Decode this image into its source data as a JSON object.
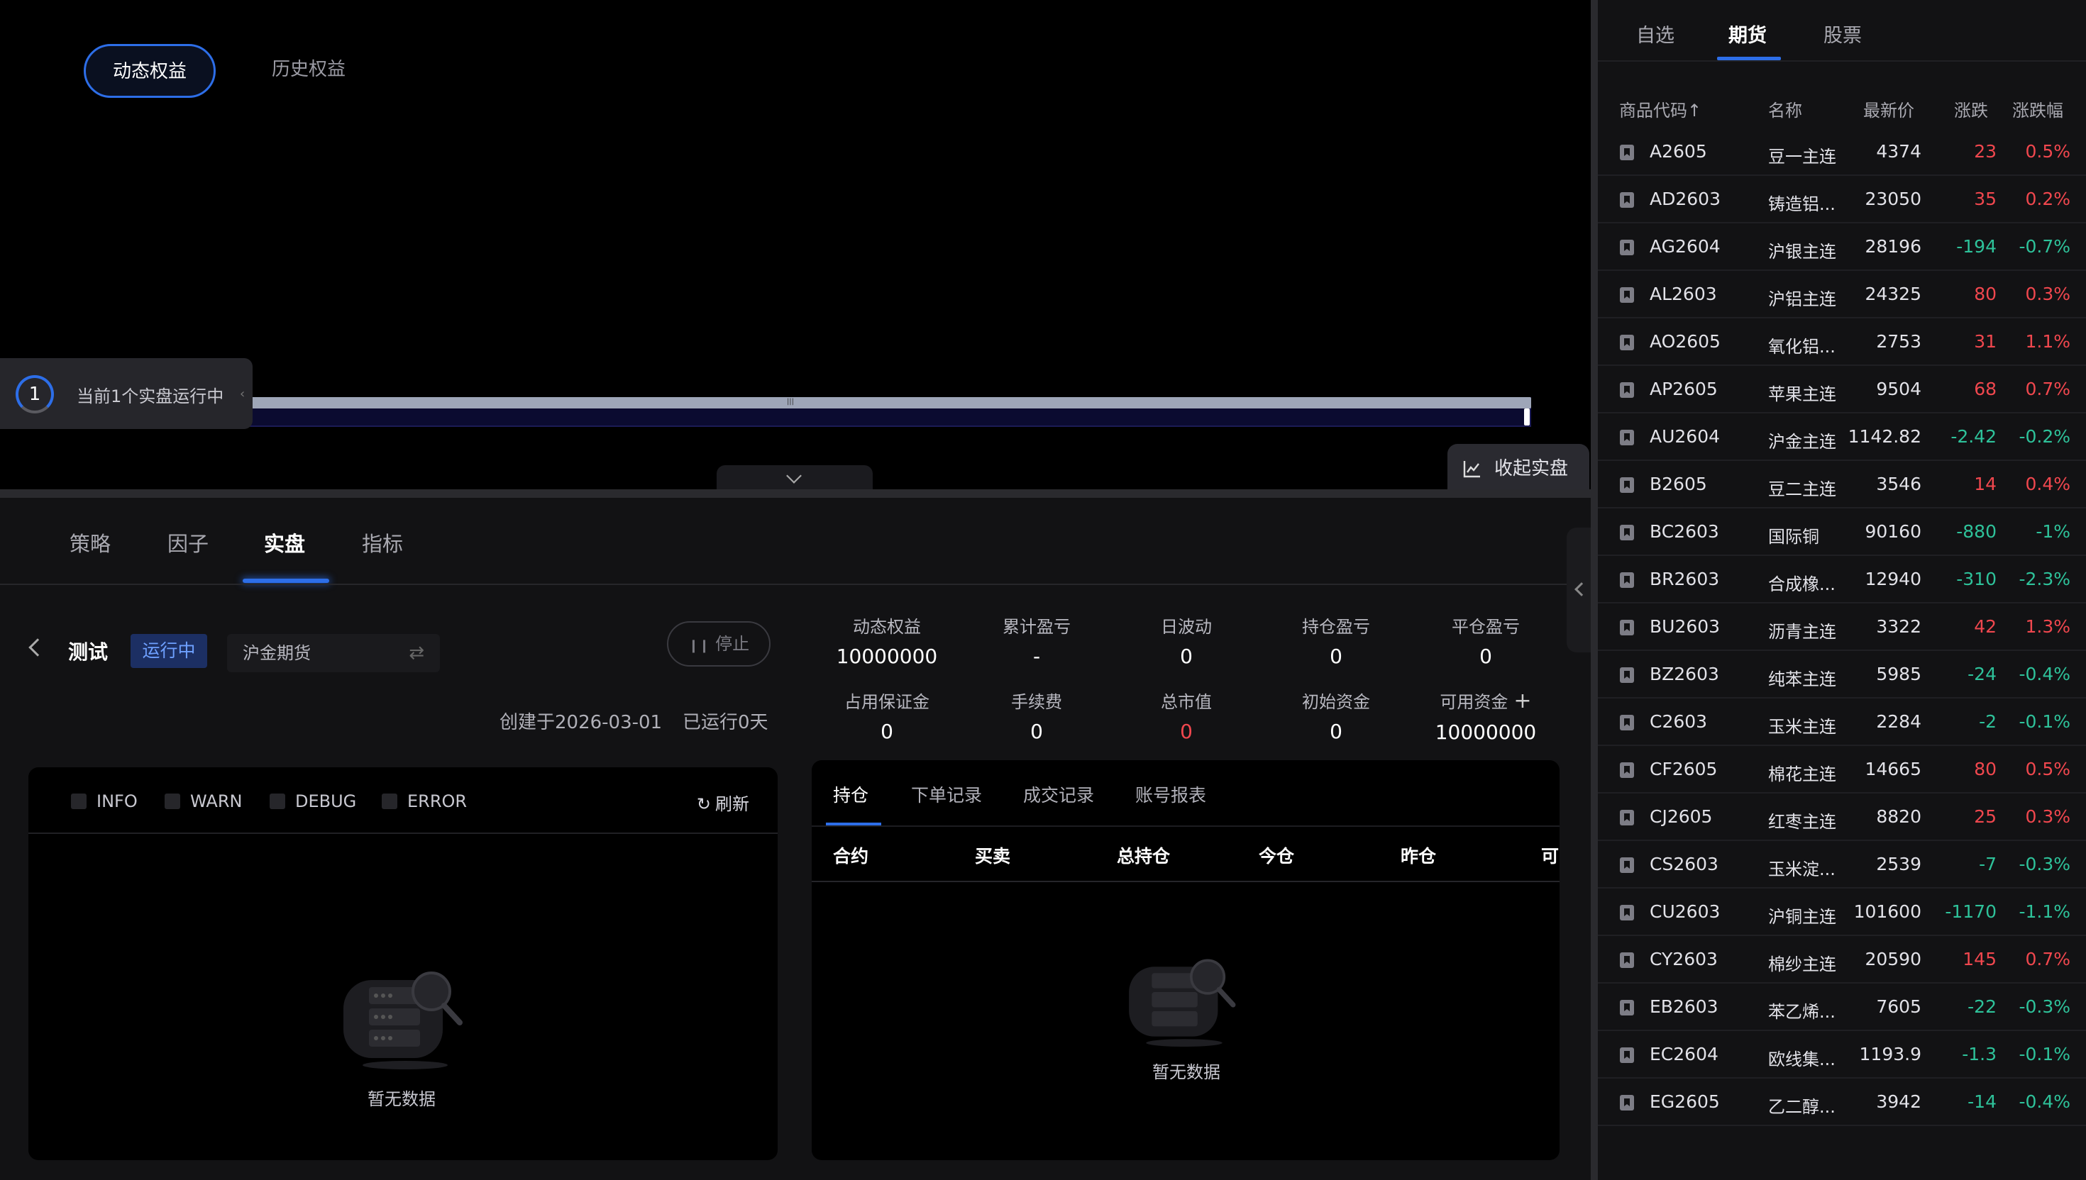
{
  "chart_header": {
    "tabs": [
      {
        "label": "动态权益",
        "active": true
      },
      {
        "label": "历史权益",
        "active": false
      }
    ]
  },
  "running_pill": {
    "count": "1",
    "text": "当前1个实盘运行中"
  },
  "collapse_live": {
    "label": "收起实盘"
  },
  "main_tabs": [
    {
      "label": "策略",
      "active": false
    },
    {
      "label": "因子",
      "active": false
    },
    {
      "label": "实盘",
      "active": true
    },
    {
      "label": "指标",
      "active": false
    }
  ],
  "strategy": {
    "name": "测试",
    "status": "运行中",
    "account": "沪金期货",
    "stop_label": "停止",
    "created_at": "创建于2026-03-01",
    "run_days": "已运行0天"
  },
  "metrics": [
    {
      "label": "动态权益",
      "value": "10000000"
    },
    {
      "label": "累计盈亏",
      "value": "-"
    },
    {
      "label": "日波动",
      "value": "0"
    },
    {
      "label": "持仓盈亏",
      "value": "0"
    },
    {
      "label": "平仓盈亏",
      "value": "0"
    },
    {
      "label": "占用保证金",
      "value": "0"
    },
    {
      "label": "手续费",
      "value": "0"
    },
    {
      "label": "总市值",
      "value": "0"
    },
    {
      "label": "初始资金",
      "value": "0"
    },
    {
      "label": "可用资金",
      "value": "10000000"
    }
  ],
  "log_panel": {
    "levels": [
      "INFO",
      "WARN",
      "DEBUG",
      "ERROR"
    ],
    "refresh_label": "刷新",
    "empty_text": "暂无数据"
  },
  "position_panel": {
    "tabs": [
      {
        "label": "持仓",
        "active": true
      },
      {
        "label": "下单记录",
        "active": false
      },
      {
        "label": "成交记录",
        "active": false
      },
      {
        "label": "账号报表",
        "active": false
      }
    ],
    "columns": [
      "合约",
      "买卖",
      "总持仓",
      "今仓",
      "昨仓",
      "可"
    ],
    "empty_text": "暂无数据"
  },
  "market": {
    "tabs": [
      {
        "label": "自选",
        "active": false
      },
      {
        "label": "期货",
        "active": true
      },
      {
        "label": "股票",
        "active": false
      }
    ],
    "headers": [
      "商品代码↑",
      "名称",
      "最新价",
      "涨跌",
      "涨跌幅"
    ],
    "rows": [
      {
        "code": "A2605",
        "name": "豆一主连",
        "price": "4374",
        "change": "23",
        "pct": "0.5%",
        "dir": "up"
      },
      {
        "code": "AD2603",
        "name": "铸造铝...",
        "price": "23050",
        "change": "35",
        "pct": "0.2%",
        "dir": "up"
      },
      {
        "code": "AG2604",
        "name": "沪银主连",
        "price": "28196",
        "change": "-194",
        "pct": "-0.7%",
        "dir": "down"
      },
      {
        "code": "AL2603",
        "name": "沪铝主连",
        "price": "24325",
        "change": "80",
        "pct": "0.3%",
        "dir": "up"
      },
      {
        "code": "AO2605",
        "name": "氧化铝...",
        "price": "2753",
        "change": "31",
        "pct": "1.1%",
        "dir": "up"
      },
      {
        "code": "AP2605",
        "name": "苹果主连",
        "price": "9504",
        "change": "68",
        "pct": "0.7%",
        "dir": "up"
      },
      {
        "code": "AU2604",
        "name": "沪金主连",
        "price": "1142.82",
        "change": "-2.42",
        "pct": "-0.2%",
        "dir": "down"
      },
      {
        "code": "B2605",
        "name": "豆二主连",
        "price": "3546",
        "change": "14",
        "pct": "0.4%",
        "dir": "up"
      },
      {
        "code": "BC2603",
        "name": "国际铜",
        "price": "90160",
        "change": "-880",
        "pct": "-1%",
        "dir": "down"
      },
      {
        "code": "BR2603",
        "name": "合成橡...",
        "price": "12940",
        "change": "-310",
        "pct": "-2.3%",
        "dir": "down"
      },
      {
        "code": "BU2603",
        "name": "沥青主连",
        "price": "3322",
        "change": "42",
        "pct": "1.3%",
        "dir": "up"
      },
      {
        "code": "BZ2603",
        "name": "纯苯主连",
        "price": "5985",
        "change": "-24",
        "pct": "-0.4%",
        "dir": "down"
      },
      {
        "code": "C2603",
        "name": "玉米主连",
        "price": "2284",
        "change": "-2",
        "pct": "-0.1%",
        "dir": "down"
      },
      {
        "code": "CF2605",
        "name": "棉花主连",
        "price": "14665",
        "change": "80",
        "pct": "0.5%",
        "dir": "up"
      },
      {
        "code": "CJ2605",
        "name": "红枣主连",
        "price": "8820",
        "change": "25",
        "pct": "0.3%",
        "dir": "up"
      },
      {
        "code": "CS2603",
        "name": "玉米淀...",
        "price": "2539",
        "change": "-7",
        "pct": "-0.3%",
        "dir": "down"
      },
      {
        "code": "CU2603",
        "name": "沪铜主连",
        "price": "101600",
        "change": "-1170",
        "pct": "-1.1%",
        "dir": "down"
      },
      {
        "code": "CY2603",
        "name": "棉纱主连",
        "price": "20590",
        "change": "145",
        "pct": "0.7%",
        "dir": "up"
      },
      {
        "code": "EB2603",
        "name": "苯乙烯...",
        "price": "7605",
        "change": "-22",
        "pct": "-0.3%",
        "dir": "down"
      },
      {
        "code": "EC2604",
        "name": "欧线集...",
        "price": "1193.9",
        "change": "-1.3",
        "pct": "-0.1%",
        "dir": "down"
      },
      {
        "code": "EG2605",
        "name": "乙二醇...",
        "price": "3942",
        "change": "-14",
        "pct": "-0.4%",
        "dir": "down"
      }
    ]
  },
  "colors": {
    "accent": "#2d6ee8",
    "up": "#f0474e",
    "down": "#2ec29a",
    "status_tag_bg": "#1c2f63"
  }
}
